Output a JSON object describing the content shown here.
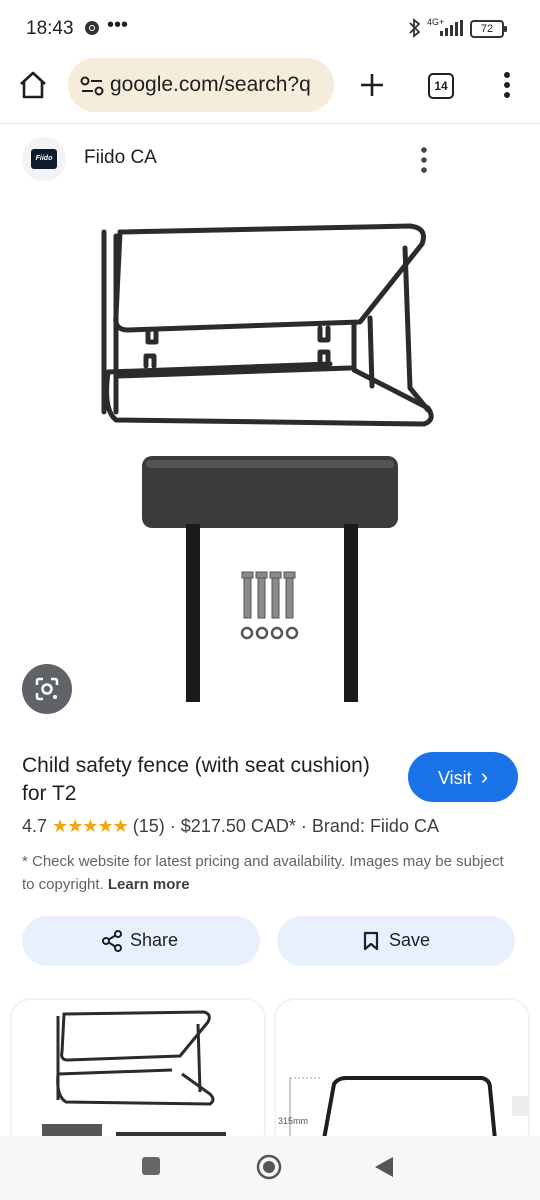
{
  "status_bar": {
    "time": "18:43",
    "network": "4G+",
    "battery": "72"
  },
  "browser": {
    "url": "google.com/search?q",
    "tab_count": "14"
  },
  "source": {
    "name": "Fiido CA",
    "logo_text": "Fiido"
  },
  "product": {
    "title": "Child safety fence (with seat cushion) for T2",
    "rating": "4.7",
    "stars": "★★★★★",
    "review_count": "(15)",
    "separator": "·",
    "price": "$217.50 CAD*",
    "brand": "Brand: Fiido CA"
  },
  "visit_button": {
    "label": "Visit",
    "chevron": "›"
  },
  "disclaimer": {
    "text": "* Check website for latest pricing and availability. Images may be subject to copyright.",
    "learn_more": "Learn more"
  },
  "actions": {
    "share_label": "Share",
    "save_label": "Save"
  },
  "related": {
    "dimension_label": "315mm"
  },
  "colors": {
    "accent": "#1a73e8",
    "omnibox": "#f6ecdc",
    "action_pill": "#e8f0fe",
    "star": "#f2a60c"
  },
  "icons": [
    "home-icon",
    "site-settings-icon",
    "new-tab-plus-icon",
    "tab-switcher-icon",
    "more-vert-icon",
    "google-lens-icon",
    "share-icon",
    "bookmark-icon",
    "recents-square-icon",
    "home-circle-icon",
    "back-triangle-icon"
  ]
}
